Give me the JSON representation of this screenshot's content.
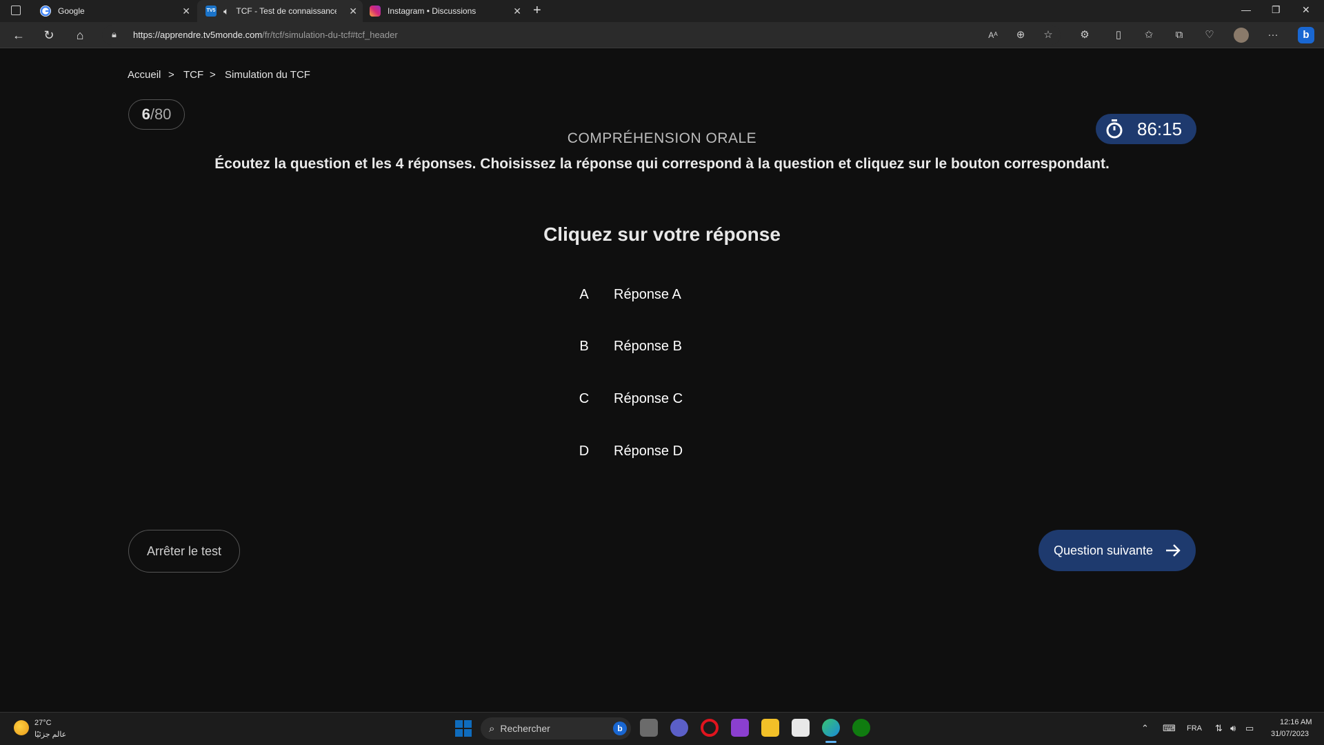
{
  "browser": {
    "tabs": [
      {
        "title": "Google",
        "icon": "google-icon"
      },
      {
        "title": "TCF - Test de connaissance ·",
        "icon": "tv5monde-icon",
        "audio": true
      },
      {
        "title": "Instagram • Discussions",
        "icon": "instagram-icon"
      }
    ],
    "url_domain": "https://apprendre.tv5monde.com",
    "url_path": "/fr/tcf/simulation-du-tcf#tcf_header"
  },
  "breadcrumb": {
    "items": [
      "Accueil",
      "TCF",
      "Simulation du TCF"
    ],
    "separator": ">"
  },
  "progress": {
    "current": "6",
    "total": "/80"
  },
  "timer": {
    "value": "86:15"
  },
  "section_title": "COMPRÉHENSION ORALE",
  "instruction": "Écoutez la question et les 4 réponses. Choisissez la réponse qui correspond à la question et cliquez sur le bouton correspondant.",
  "prompt": "Cliquez sur votre réponse",
  "answers": [
    {
      "letter": "A",
      "label": "Réponse A"
    },
    {
      "letter": "B",
      "label": "Réponse B"
    },
    {
      "letter": "C",
      "label": "Réponse C"
    },
    {
      "letter": "D",
      "label": "Réponse D"
    }
  ],
  "buttons": {
    "stop": "Arrêter le test",
    "next": "Question suivante"
  },
  "taskbar": {
    "weather_temp": "27°C",
    "weather_desc": "عالم جزئيًا",
    "search_placeholder": "Rechercher",
    "lang": "FRA",
    "time": "12:16 AM",
    "date": "31/07/2023"
  },
  "colors": {
    "accent": "#1e3a6e",
    "background": "#0f0f0f"
  }
}
